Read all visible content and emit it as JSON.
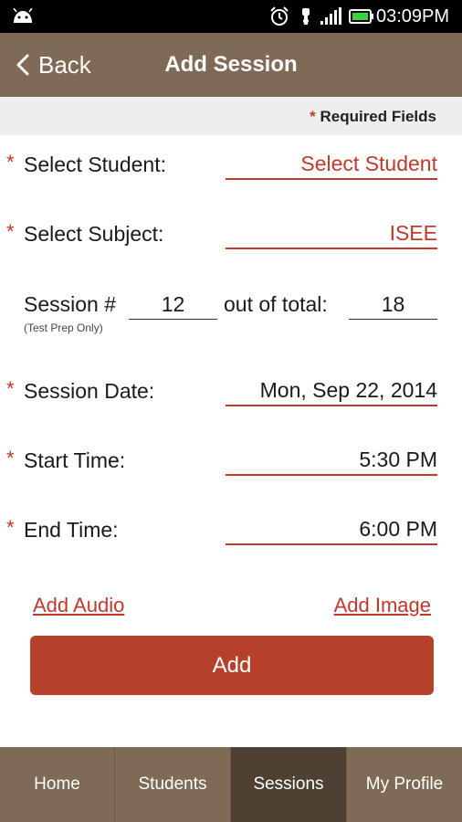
{
  "status_bar": {
    "time": "03:09PM",
    "icons": [
      "android-icon",
      "alarm-icon",
      "usb-icon",
      "signal-icon",
      "battery-icon"
    ]
  },
  "header": {
    "back_label": "Back",
    "title": "Add Session"
  },
  "required_note": {
    "star": "*",
    "text": "Required Fields"
  },
  "form": {
    "student": {
      "label": "Select Student:",
      "value": "Select Student",
      "required": "*"
    },
    "subject": {
      "label": "Select Subject:",
      "value": "ISEE",
      "required": "*"
    },
    "session": {
      "label": "Session #",
      "number": "12",
      "total_label": "out of total:",
      "total": "18",
      "note": "(Test Prep Only)"
    },
    "date": {
      "label": "Session Date:",
      "value": "Mon, Sep 22, 2014",
      "required": "*"
    },
    "start": {
      "label": "Start Time:",
      "value": "5:30 PM",
      "required": "*"
    },
    "end": {
      "label": "End Time:",
      "value": "6:00 PM",
      "required": "*"
    }
  },
  "actions": {
    "add_audio": "Add Audio",
    "add_image": "Add Image",
    "add": "Add"
  },
  "bottom_nav": {
    "tabs": [
      {
        "label": "Home",
        "active": false
      },
      {
        "label": "Students",
        "active": false
      },
      {
        "label": "Sessions",
        "active": true
      },
      {
        "label": "My Profile",
        "active": false
      }
    ]
  },
  "colors": {
    "brand_brown": "#7e6a55",
    "active_tab": "#4e4133",
    "accent_red": "#c0392b",
    "button_red": "#b5412a"
  }
}
